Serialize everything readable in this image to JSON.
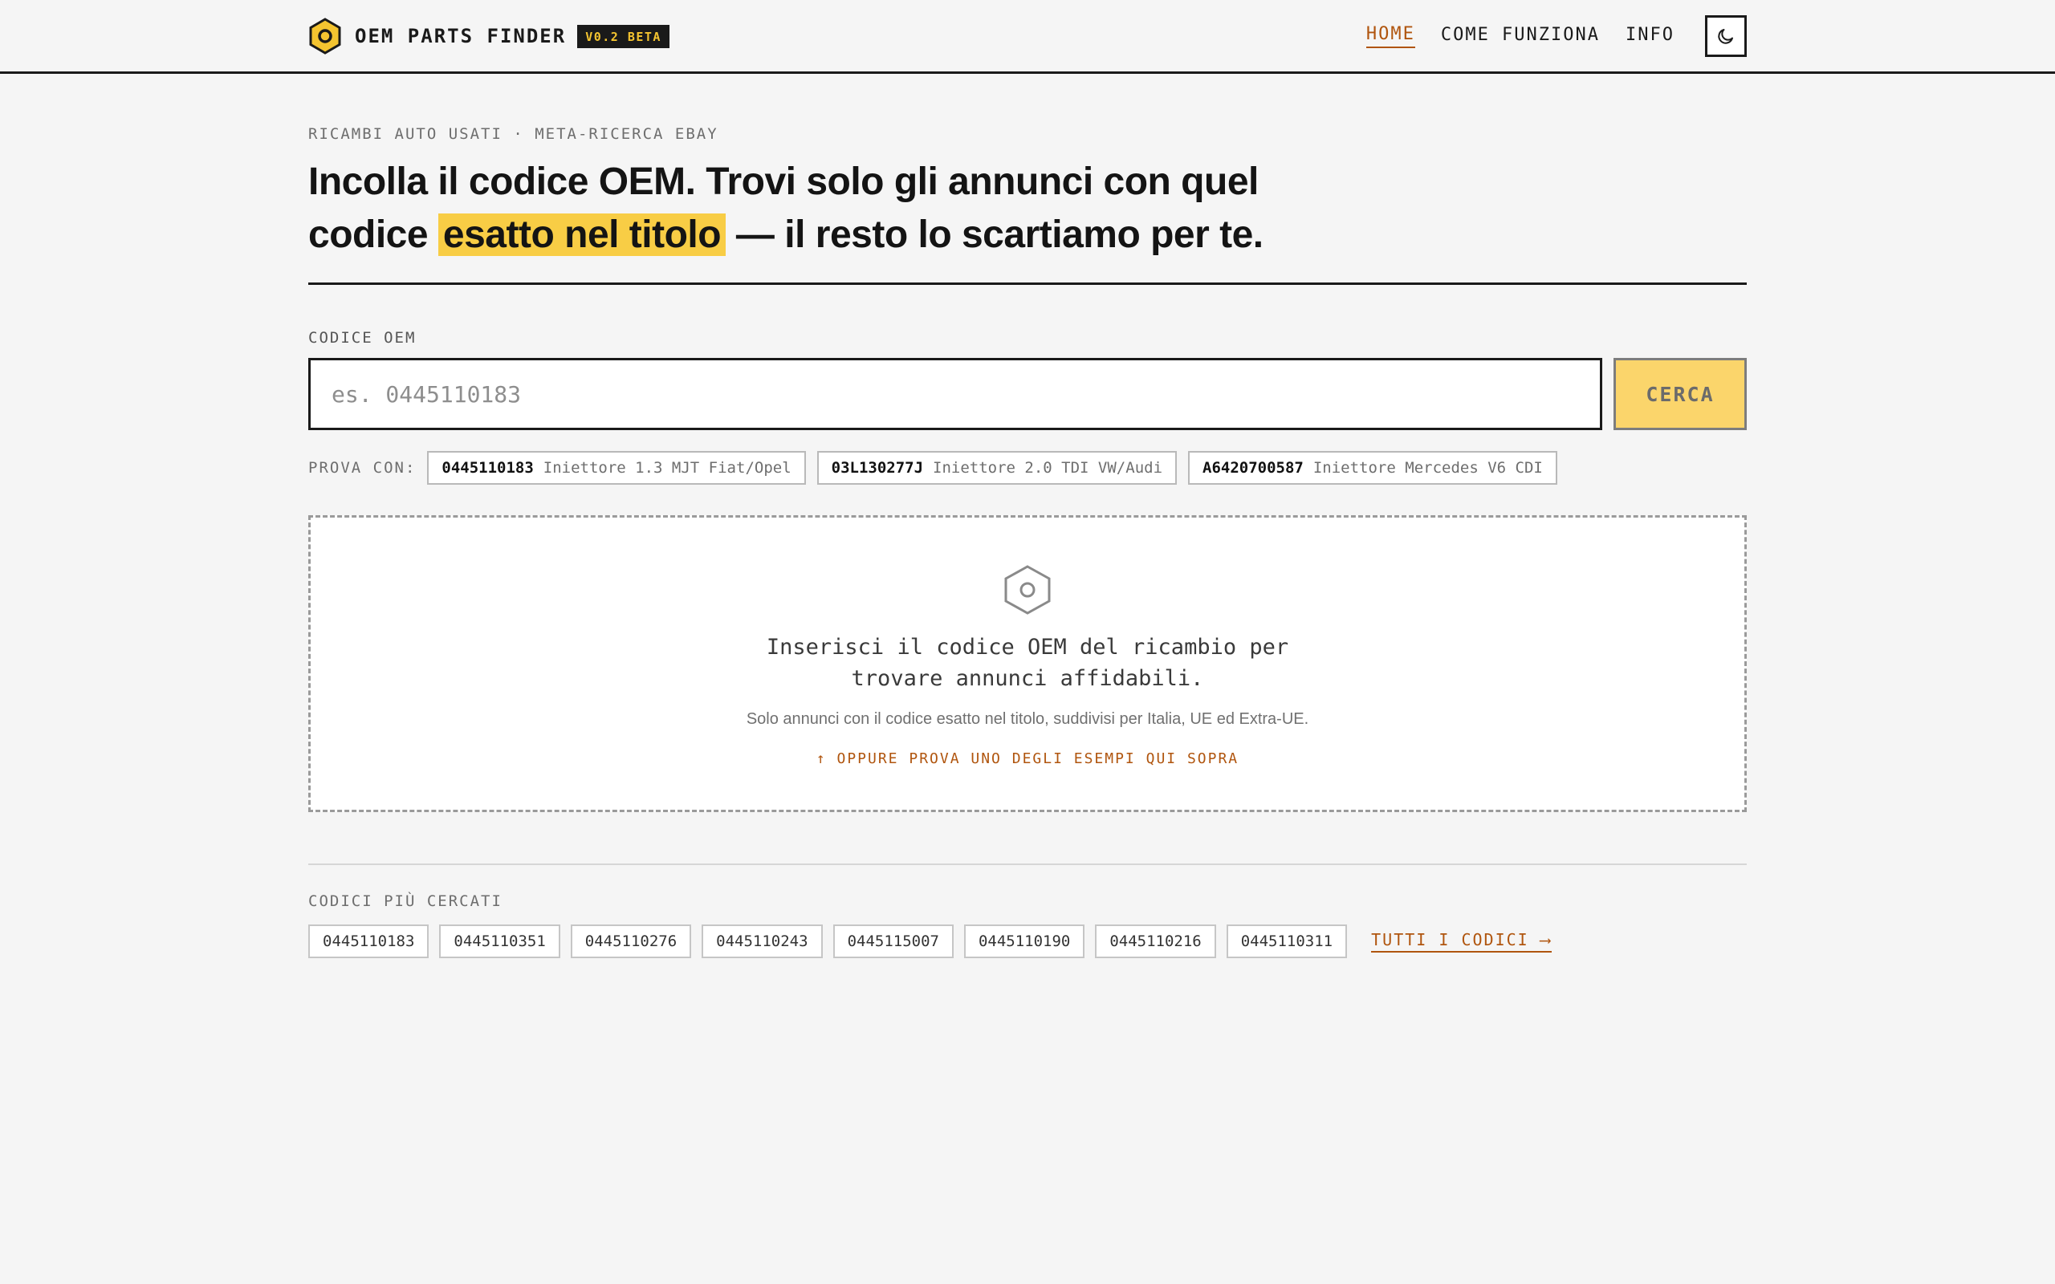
{
  "header": {
    "brand_name": "OEM PARTS FINDER",
    "beta_badge": "V0.2 BETA",
    "nav": [
      {
        "label": "HOME",
        "active": true
      },
      {
        "label": "COME FUNZIONA",
        "active": false
      },
      {
        "label": "INFO",
        "active": false
      }
    ],
    "theme_toggle_icon": "moon-icon"
  },
  "hero": {
    "kicker": "RICAMBI AUTO USATI · META-RICERCA EBAY",
    "title_part1": "Incolla il codice OEM. Trovi solo gli annunci con quel codice ",
    "title_highlight": "esatto nel titolo",
    "title_part2": " — il resto lo scartiamo per te."
  },
  "search": {
    "label": "CODICE OEM",
    "placeholder": "es. 0445110183",
    "value": "",
    "button_label": "CERCA"
  },
  "examples": {
    "label": "PROVA CON:",
    "items": [
      {
        "code": "0445110183",
        "desc": "Iniettore 1.3 MJT Fiat/Opel"
      },
      {
        "code": "03L130277J",
        "desc": "Iniettore 2.0 TDI VW/Audi"
      },
      {
        "code": "A6420700587",
        "desc": "Iniettore Mercedes V6 CDI"
      }
    ]
  },
  "empty_state": {
    "icon": "hex-nut-icon",
    "title_line1": "Inserisci il codice OEM del ricambio per",
    "title_line2": "trovare annunci affidabili.",
    "subtitle": "Solo annunci con il codice esatto nel titolo, suddivisi per Italia, UE ed Extra-UE.",
    "hint": "↑ OPPURE PROVA UNO DEGLI ESEMPI QUI SOPRA"
  },
  "popular": {
    "label": "CODICI PIÙ CERCATI",
    "codes": [
      "0445110183",
      "0445110351",
      "0445110276",
      "0445110243",
      "0445115007",
      "0445110190",
      "0445110216",
      "0445110311"
    ],
    "all_link": "TUTTI I CODICI ⟶"
  },
  "colors": {
    "accent": "#b0550e",
    "highlight": "#f8cd45",
    "brand_yellow": "#f4c430",
    "ink": "#1a1a1a",
    "background": "#f5f5f5"
  }
}
